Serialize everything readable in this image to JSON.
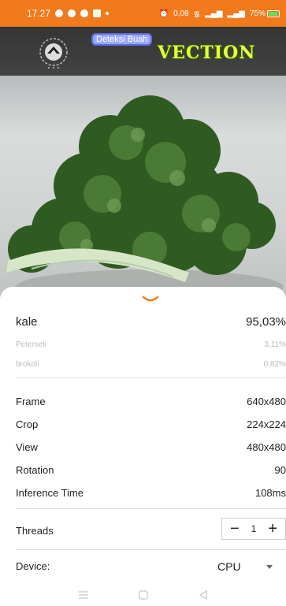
{
  "status_bar": {
    "time": "17.27",
    "network_speed": "0,08",
    "battery": "75%",
    "colors": {
      "background": "#f07a1c"
    }
  },
  "camera": {
    "brand_pill": "Deteksi Buah",
    "brand_title": "VECTION"
  },
  "results": [
    {
      "label": "kale",
      "value": "95,03%"
    },
    {
      "label": "Peterseli",
      "value": "3,11%"
    },
    {
      "label": "brokoli",
      "value": "0,82%"
    }
  ],
  "info": [
    {
      "label": "Frame",
      "value": "640x480"
    },
    {
      "label": "Crop",
      "value": "224x224"
    },
    {
      "label": "View",
      "value": "480x480"
    },
    {
      "label": "Rotation",
      "value": "90"
    },
    {
      "label": "Inference Time",
      "value": "108ms"
    }
  ],
  "threads": {
    "label": "Threads",
    "value": "1",
    "minus": "−",
    "plus": "+"
  },
  "device": {
    "label": "Device:",
    "selected": "CPU"
  },
  "icons": {
    "panel_toggle": "chevron-down-icon",
    "nav": [
      "menu-icon",
      "home-icon",
      "back-icon"
    ]
  },
  "colors": {
    "accent": "#f07a1c",
    "brand_title": "#e6ff3a"
  }
}
